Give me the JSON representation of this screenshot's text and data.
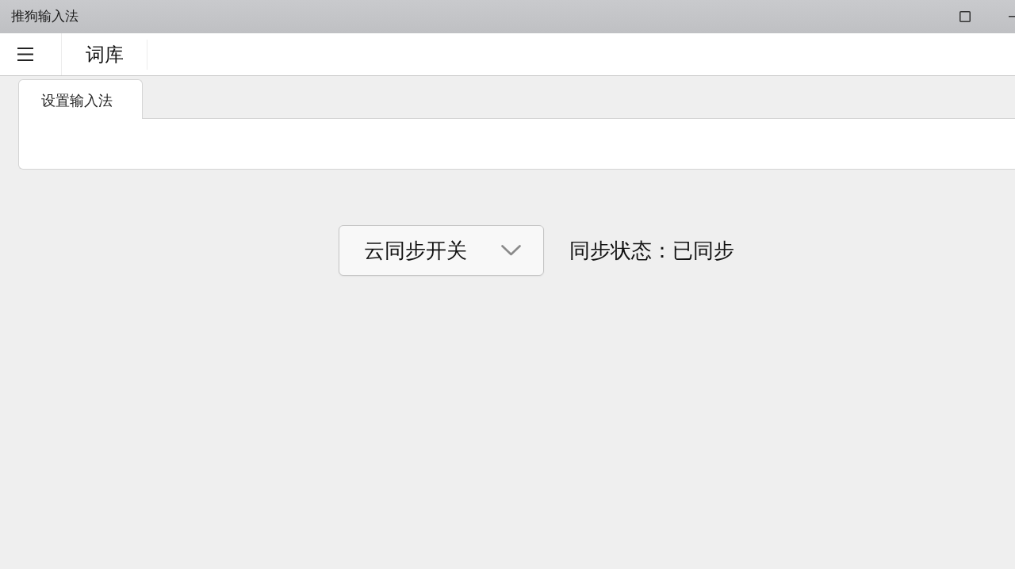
{
  "window": {
    "title": "推狗输入法"
  },
  "toolbar": {
    "title": "词库"
  },
  "tabs": [
    {
      "label": "设置输入法",
      "selected": true
    }
  ],
  "sync": {
    "dropdown": {
      "value": "云同步开关"
    },
    "status": "同步状态：已同步"
  }
}
